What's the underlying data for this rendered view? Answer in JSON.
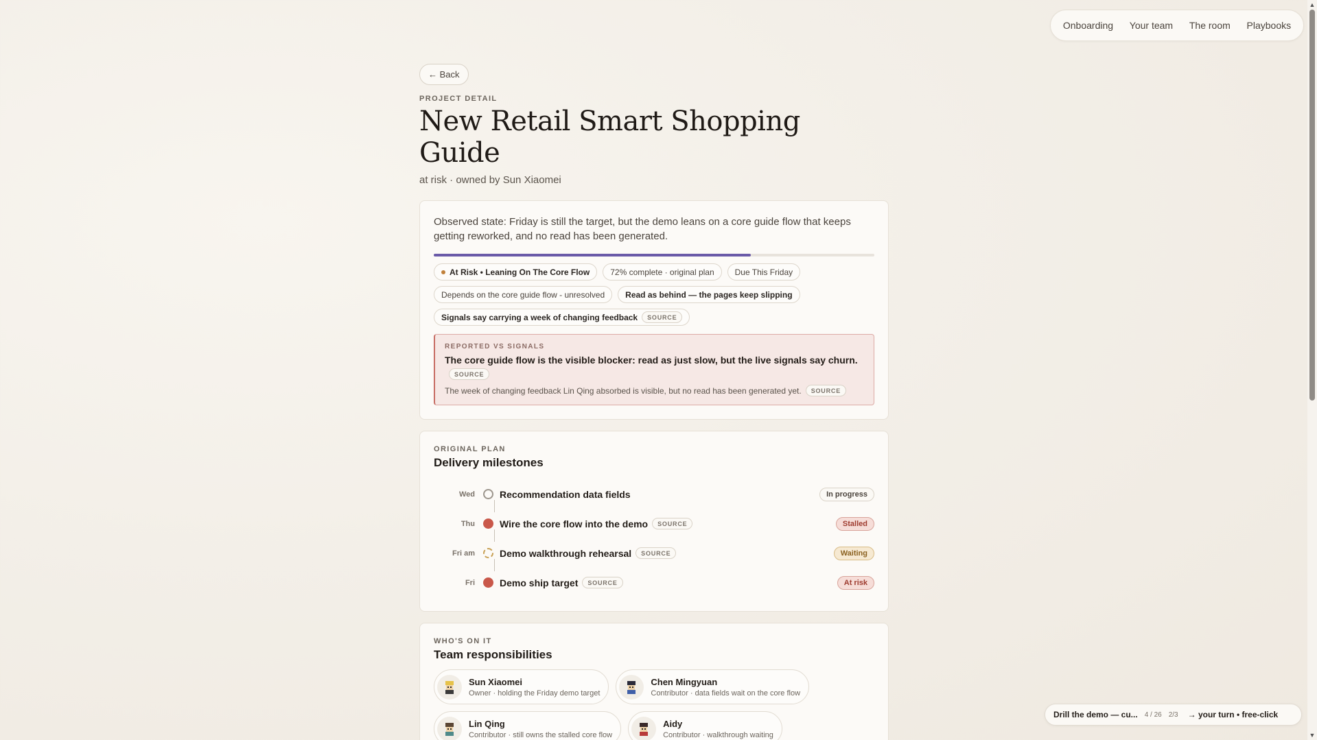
{
  "nav": {
    "items": [
      "Onboarding",
      "Your team",
      "The room",
      "Playbooks"
    ]
  },
  "back": {
    "label": "← Back"
  },
  "header": {
    "eyebrow": "PROJECT DETAIL",
    "title": "New Retail Smart Shopping Guide",
    "subtitle": "at risk · owned by Sun Xiaomei"
  },
  "status": {
    "observed": "Observed state: Friday is still the target, but the demo leans on a core guide flow that keeps getting reworked, and no read has been generated.",
    "progress_fraction": 0.72,
    "chips": [
      {
        "label": "At Risk • Leaning On The Core Flow",
        "bold": true,
        "dot": true
      },
      {
        "label": "72% complete · original plan"
      },
      {
        "label": "Due This Friday"
      },
      {
        "label": "Depends on the core guide flow - unresolved"
      },
      {
        "label": "Read as behind — the pages keep slipping",
        "bold": true
      },
      {
        "label": "Signals say carrying a week of changing feedback",
        "bold": true,
        "source": "SOURCE"
      }
    ],
    "alert": {
      "eyebrow": "REPORTED VS SIGNALS",
      "headline": "The core guide flow is the visible blocker: read as just slow, but the live signals say churn.",
      "headline_source": "SOURCE",
      "detail": "The week of changing feedback Lin Qing absorbed is visible, but no read has been generated yet.",
      "detail_source": "SOURCE"
    }
  },
  "milestones": {
    "eyebrow": "ORIGINAL PLAN",
    "title": "Delivery milestones",
    "items": [
      {
        "day": "Wed",
        "label": "Recommendation data fields",
        "status": "In progress",
        "source": ""
      },
      {
        "day": "Thu",
        "label": "Wire the core flow into the demo",
        "status": "Stalled",
        "source": "SOURCE"
      },
      {
        "day": "Fri am",
        "label": "Demo walkthrough rehearsal",
        "status": "Waiting",
        "source": "SOURCE"
      },
      {
        "day": "Fri",
        "label": "Demo ship target",
        "status": "At risk",
        "source": "SOURCE"
      }
    ]
  },
  "team": {
    "eyebrow": "WHO'S ON IT",
    "title": "Team responsibilities",
    "people": [
      {
        "name": "Sun Xiaomei",
        "role": "Owner · holding the Friday demo target"
      },
      {
        "name": "Chen Mingyuan",
        "role": "Contributor · data fields wait on the core flow"
      },
      {
        "name": "Lin Qing",
        "role": "Contributor · still owns the stalled core flow"
      },
      {
        "name": "Aidy",
        "role": "Contributor · walkthrough waiting"
      }
    ]
  },
  "toast": {
    "title": "Drill the demo — cu...",
    "count": "4 / 26",
    "step": "2/3",
    "action": "→ your turn • free-click"
  },
  "colors": {
    "accent": "#6a5aa8",
    "risk": "#c9584a",
    "waiting": "#c8a054"
  }
}
